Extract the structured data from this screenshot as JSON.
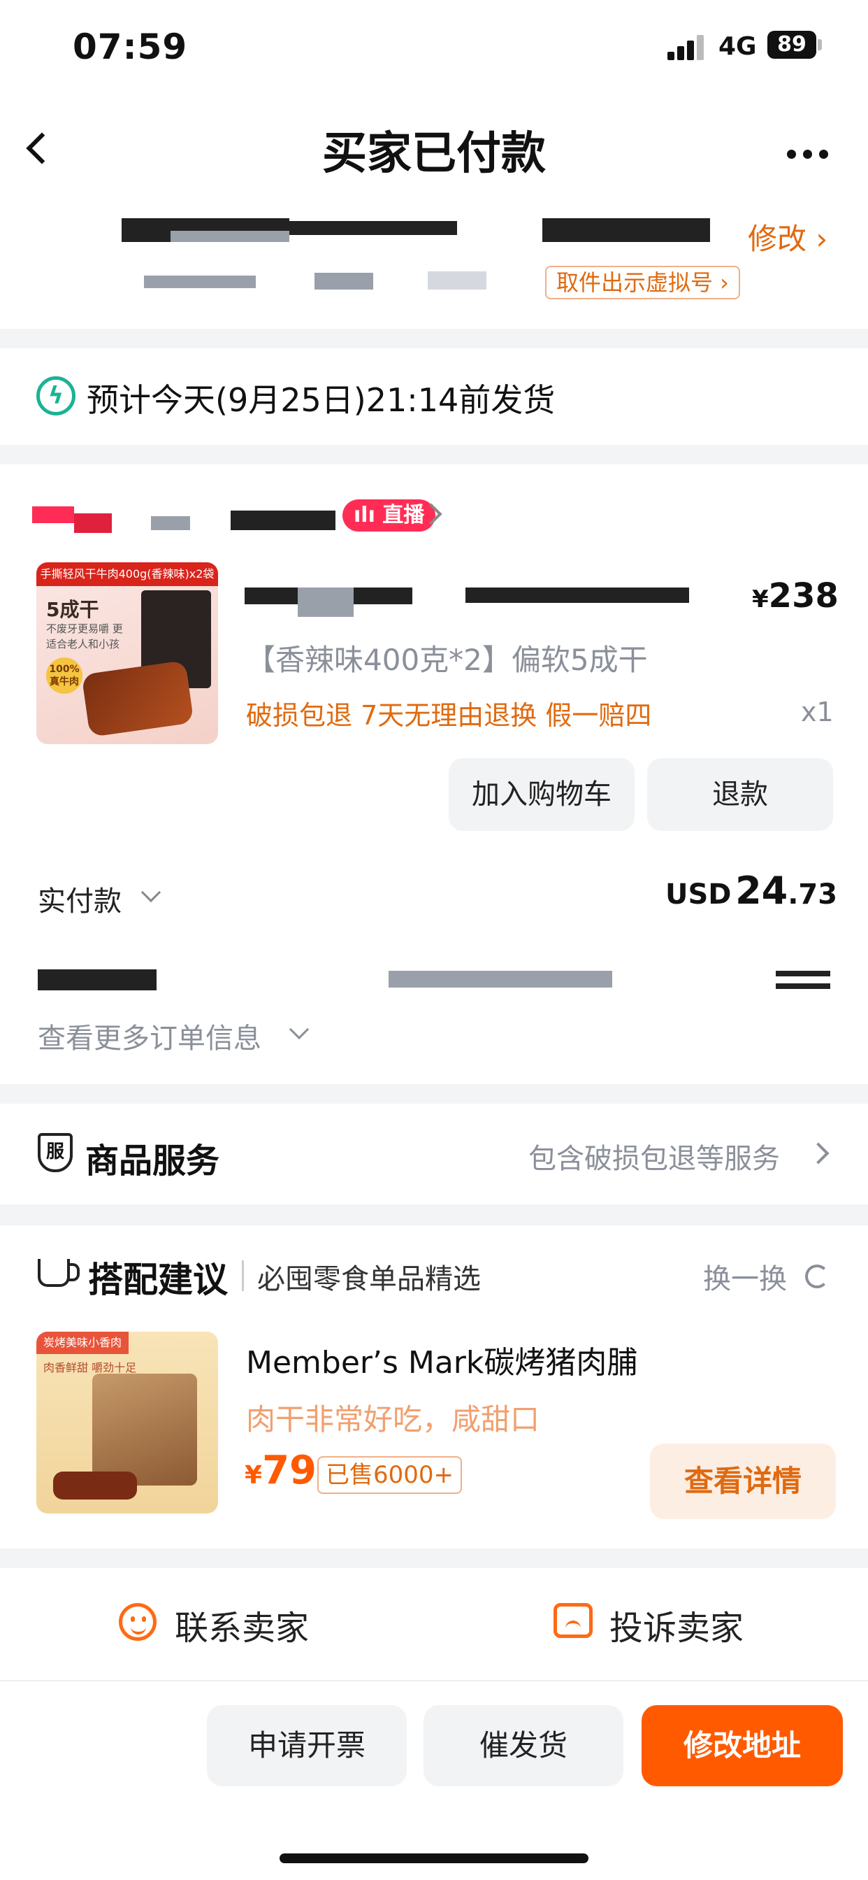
{
  "status_bar": {
    "time": "07:59",
    "network": "4G",
    "battery": "89"
  },
  "nav": {
    "title": "买家已付款"
  },
  "address": {
    "edit_label": "修改 ›",
    "virtual_number_btn": "取件出示虚拟号 ›"
  },
  "shipping": {
    "text": "预计今天(9月25日)21:14前发货"
  },
  "order": {
    "live_badge": "直播",
    "thumb_banner": "手撕轻风干牛肉400g(香辣味)x2袋",
    "thumb_title": "5成干",
    "thumb_sub": "不废牙更易嚼 更适合老人和小孩",
    "thumb_badge": "100% 真牛肉",
    "price_symbol": "¥",
    "price": "238",
    "sku": "【香辣味400克*2】偏软5成干",
    "guarantees": "破损包退  7天无理由退换  假一赔四",
    "qty": "x1",
    "add_cart_btn": "加入购物车",
    "refund_btn": "退款",
    "paid_label": "实付款",
    "paid_currency": "USD",
    "paid_int": "24",
    "paid_dec": ".73",
    "more_info": "查看更多订单信息"
  },
  "service": {
    "icon_text": "服",
    "title": "商品服务",
    "desc": "包含破损包退等服务"
  },
  "recommend": {
    "title": "搭配建议",
    "subtitle": "必囤零食单品精选",
    "refresh": "换一换",
    "thumb_tag": "炭烤美味小香肉",
    "thumb_sub": "肉香鲜甜 嚼劲十足",
    "name": "Member’s Mark碳烤猪肉脯",
    "desc": "肉干非常好吃，咸甜口",
    "price_symbol": "¥",
    "price": "79",
    "sold": "已售6000+",
    "detail_btn": "查看详情"
  },
  "contact": {
    "contact_seller": "联系卖家",
    "complain_seller": "投诉卖家"
  },
  "bottom": {
    "invoice_btn": "申请开票",
    "urge_btn": "催发货",
    "modify_address_btn": "修改地址"
  },
  "colors": {
    "accent": "#ff5a00",
    "link": "#e06a10",
    "green": "#1ab394",
    "live": "#ff2d55"
  }
}
